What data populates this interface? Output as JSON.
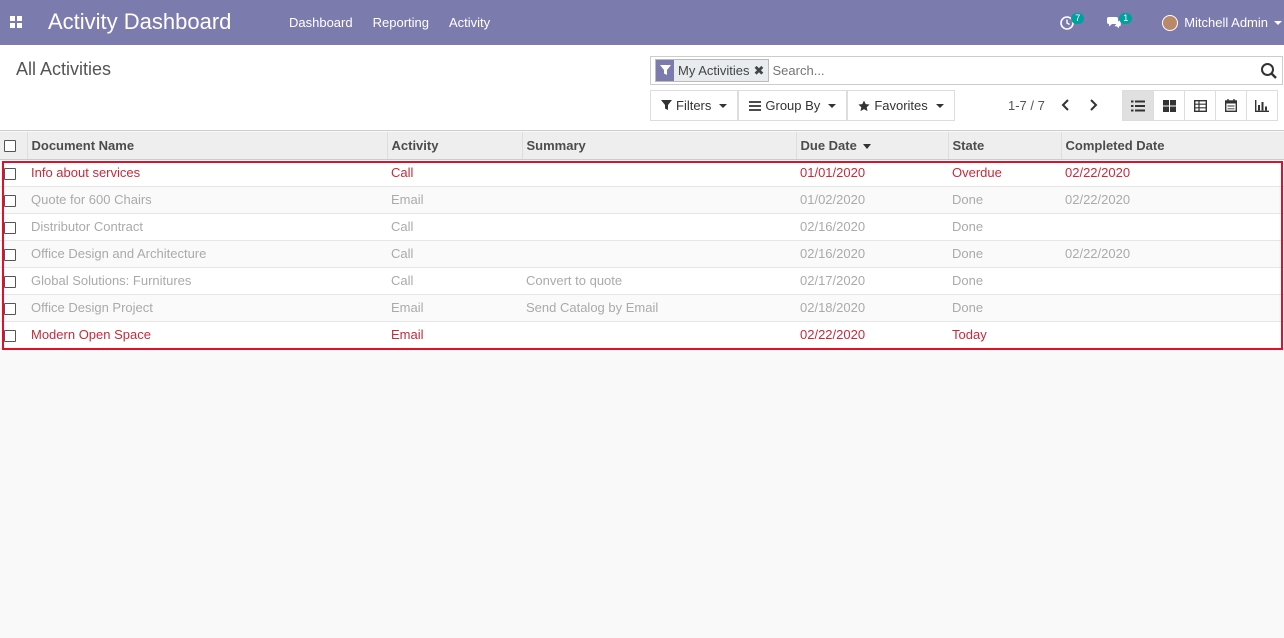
{
  "navbar": {
    "app_title": "Activity Dashboard",
    "menu": [
      "Dashboard",
      "Reporting",
      "Activity"
    ],
    "activity_count": "7",
    "message_count": "1",
    "user_name": "Mitchell Admin"
  },
  "control_panel": {
    "breadcrumb": "All Activities",
    "search": {
      "facet_label": "My Activities",
      "placeholder": "Search..."
    },
    "filters_label": "Filters",
    "group_by_label": "Group By",
    "favorites_label": "Favorites",
    "pager": "1-7 / 7"
  },
  "table": {
    "headers": [
      "Document Name",
      "Activity",
      "Summary",
      "Due Date",
      "State",
      "Completed Date"
    ],
    "rows": [
      {
        "name": "Info about services",
        "activity": "Call",
        "summary": "",
        "due": "01/01/2020",
        "state": "Overdue",
        "completed": "02/22/2020"
      },
      {
        "name": "Quote for 600 Chairs",
        "activity": "Email",
        "summary": "",
        "due": "01/02/2020",
        "state": "Done",
        "completed": "02/22/2020"
      },
      {
        "name": "Distributor Contract",
        "activity": "Call",
        "summary": "",
        "due": "02/16/2020",
        "state": "Done",
        "completed": ""
      },
      {
        "name": "Office Design and Architecture",
        "activity": "Call",
        "summary": "",
        "due": "02/16/2020",
        "state": "Done",
        "completed": "02/22/2020"
      },
      {
        "name": "Global Solutions: Furnitures",
        "activity": "Call",
        "summary": "Convert to quote",
        "due": "02/17/2020",
        "state": "Done",
        "completed": ""
      },
      {
        "name": "Office Design Project",
        "activity": "Email",
        "summary": "Send Catalog by Email",
        "due": "02/18/2020",
        "state": "Done",
        "completed": ""
      },
      {
        "name": "Modern Open Space",
        "activity": "Email",
        "summary": "",
        "due": "02/22/2020",
        "state": "Today",
        "completed": ""
      }
    ]
  },
  "colors": {
    "navbar": "#7c7bad",
    "danger_text": "#c52b3c",
    "muted_text": "#aaaaaa",
    "badge": "#00a09d",
    "highlight_box": "#e0102a"
  }
}
